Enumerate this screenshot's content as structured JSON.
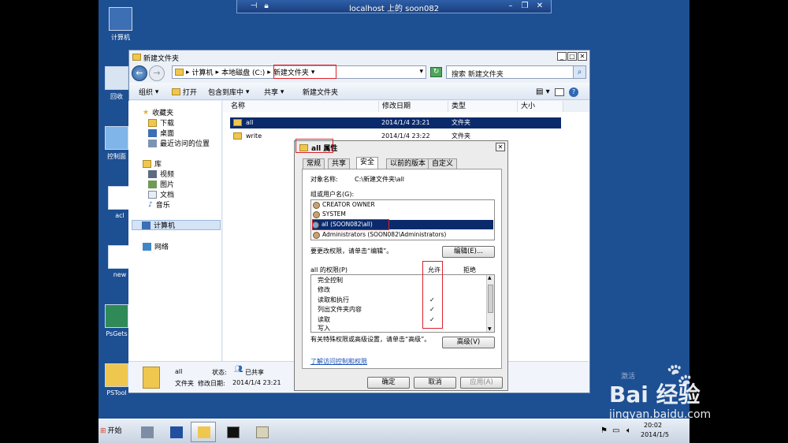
{
  "rdp": {
    "title": "localhost 上的 soon082"
  },
  "desktop": {
    "icons": [
      "计算机",
      "回收",
      "控制面",
      "acl",
      "new",
      "PsGets",
      "PSTool"
    ]
  },
  "explorer": {
    "title": "新建文件夹",
    "breadcrumb": [
      "计算机",
      "本地磁盘 (C:)",
      "新建文件夹"
    ],
    "search_placeholder": "搜索 新建文件夹",
    "toolbar": {
      "organize": "组织",
      "open": "打开",
      "include": "包含到库中",
      "share": "共享",
      "new_folder": "新建文件夹"
    },
    "nav": {
      "favorites": "收藏夹",
      "downloads": "下载",
      "desktop": "桌面",
      "recent": "最近访问的位置",
      "libraries": "库",
      "videos": "视频",
      "pictures": "图片",
      "documents": "文档",
      "music": "音乐",
      "computer": "计算机",
      "network": "网络"
    },
    "columns": {
      "name": "名称",
      "date": "修改日期",
      "type": "类型",
      "size": "大小"
    },
    "files": [
      {
        "name": "all",
        "date": "2014/1/4 23:21",
        "type": "文件夹"
      },
      {
        "name": "write",
        "date": "2014/1/4 23:22",
        "type": "文件夹"
      }
    ],
    "details": {
      "name": "all",
      "kind": "文件夹",
      "state_label": "状态:",
      "state": "已共享",
      "modified_label": "修改日期:",
      "modified": "2014/1/4 23:21"
    }
  },
  "dialog": {
    "title": "all 属性",
    "tabs": [
      "常规",
      "共享",
      "安全",
      "以前的版本",
      "自定义"
    ],
    "object_label": "对象名称:",
    "object_value": "C:\\新建文件夹\\all",
    "group_label": "组或用户名(G):",
    "users": [
      "CREATOR OWNER",
      "SYSTEM",
      "all (SOON082\\all)",
      "Administrators (SOON082\\Administrators)"
    ],
    "change_hint": "要更改权限，请单击“编辑”。",
    "edit_button": "编辑(E)...",
    "perm_title": "all 的权限(P)",
    "allow": "允许",
    "deny": "拒绝",
    "permissions": [
      {
        "name": "完全控制",
        "allow": ""
      },
      {
        "name": "修改",
        "allow": ""
      },
      {
        "name": "读取和执行",
        "allow": "✓"
      },
      {
        "name": "列出文件夹内容",
        "allow": "✓"
      },
      {
        "name": "读取",
        "allow": "✓"
      },
      {
        "name": "写入",
        "allow": ""
      }
    ],
    "advanced_hint": "有关特殊权限或高级设置，请单击“高级”。",
    "advanced_button": "高级(V)",
    "link": "了解访问控制和权限",
    "ok": "确定",
    "cancel": "取消",
    "apply": "应用(A)"
  },
  "taskbar": {
    "start": "开始",
    "time": "20:02",
    "date": "2014/1/5"
  },
  "watermark": {
    "brand": "Bai 经验",
    "url": "jingyan.baidu.com",
    "activate": "激活"
  }
}
